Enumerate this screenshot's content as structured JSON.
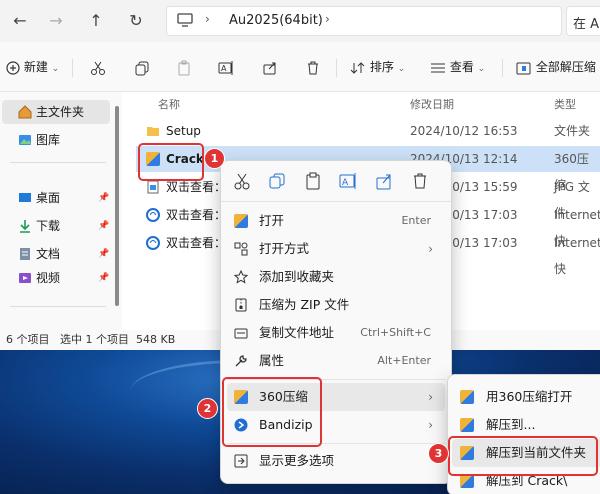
{
  "address": {
    "path": "Au2025(64bit)",
    "search_partial": "在 A"
  },
  "toolbar": {
    "new_label": "新建",
    "sort_label": "排序",
    "view_label": "查看",
    "extract_label": "全部解压缩"
  },
  "sidebar": {
    "items": [
      {
        "label": "主文件夹",
        "icon": "home-icon"
      },
      {
        "label": "图库",
        "icon": "gallery-icon"
      },
      {
        "label": "桌面",
        "icon": "desktop-icon"
      },
      {
        "label": "下载",
        "icon": "download-icon"
      },
      {
        "label": "文档",
        "icon": "document-icon"
      },
      {
        "label": "视频",
        "icon": "video-icon"
      }
    ]
  },
  "columns": {
    "name": "名称",
    "modified": "修改日期",
    "type": "类型"
  },
  "files": [
    {
      "name": "Setup",
      "date": "2024/10/12 16:53",
      "type": "文件夹"
    },
    {
      "name": "Crack",
      "date": "2024/10/13 12:14",
      "type": "360压缩"
    },
    {
      "name": "双击查看：",
      "date": "2024/10/13 15:59",
      "type": "JPG 文件"
    },
    {
      "name": "双击查看：",
      "date": "2024/10/13 17:03",
      "type": "Internet 快"
    },
    {
      "name": "双击查看：",
      "date": "2024/10/13 17:03",
      "type": "Internet 快"
    }
  ],
  "status": {
    "count": "6 个项目",
    "selected": "选中 1 个项目",
    "size": "548 KB"
  },
  "context_menu": {
    "open": "打开",
    "open_sc": "Enter",
    "open_with": "打开方式",
    "favorite": "添加到收藏夹",
    "zip": "压缩为 ZIP 文件",
    "copy_path": "复制文件地址",
    "copy_path_sc": "Ctrl+Shift+C",
    "properties": "属性",
    "properties_sc": "Alt+Enter",
    "z360": "360压缩",
    "bandizip": "Bandizip",
    "more": "显示更多选项"
  },
  "submenu": {
    "open360": "用360压缩打开",
    "extract_to": "解压到...",
    "extract_here": "解压到当前文件夹",
    "extract_crack": "解压到 Crack\\"
  },
  "badges": {
    "b1": "1",
    "b2": "2",
    "b3": "3"
  },
  "colors": {
    "highlight": "#e03434",
    "selection": "#cce1f7"
  }
}
